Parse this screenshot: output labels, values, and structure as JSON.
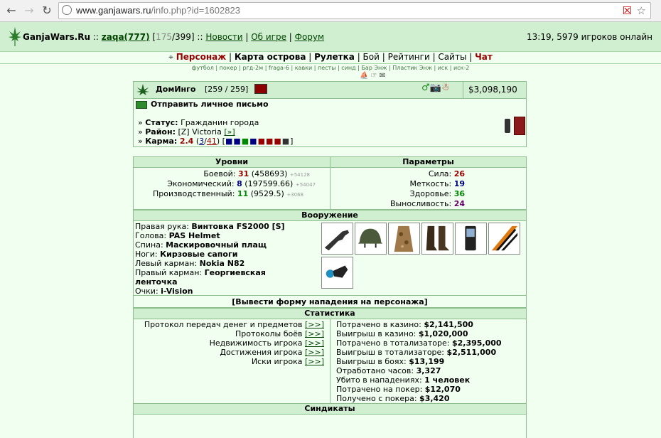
{
  "browser": {
    "url_host": "www.ganjawars.ru",
    "url_path": "/info.php?id=1602823"
  },
  "site": {
    "brand": "GanjaWars.Ru",
    "separator": "::",
    "user": "zaqa(777)",
    "counter_a": "175",
    "counter_b": "399",
    "links": [
      "Новости",
      "Об игре",
      "Форум"
    ],
    "status": "13:19, 5979 игроков онлайн"
  },
  "menu": {
    "items": [
      "Персонаж",
      "Карта острова",
      "Рулетка",
      "Бой",
      "Рейтинги",
      "Сайты",
      "Чат"
    ]
  },
  "submenu": [
    "футбол",
    "покер",
    "ргд-2м",
    "fraga-6",
    "кавки",
    "песты",
    "синд",
    "Бар Энж",
    "Пластик Энж",
    "иск",
    "иск-2"
  ],
  "profile": {
    "name": "ДомИнго",
    "hp": "[259 / 259]",
    "money": "$3,098,190",
    "send_message": "Отправить личное письмо",
    "status_label": "Статус:",
    "status_value": "Гражданин города",
    "district_label": "Район:",
    "district_value": "[Z] Victoria",
    "district_link": "[»]",
    "karma_label": "Карма:",
    "karma_value": "2.4",
    "karma_open": "(",
    "karma_pos": "3",
    "karma_slash": "/",
    "karma_neg": "41",
    "karma_close": ")"
  },
  "levels": {
    "title": "Уровни",
    "rows": [
      {
        "label": "Боевой:",
        "level": "31",
        "value": "(458693)",
        "delta": "+54128",
        "color": "#990000"
      },
      {
        "label": "Экономический:",
        "level": "8",
        "value": "(197599.66)",
        "delta": "+54047",
        "color": "#000080"
      },
      {
        "label": "Производственный:",
        "level": "11",
        "value": "(9529.5)",
        "delta": "+3068",
        "color": "#008800"
      }
    ]
  },
  "params": {
    "title": "Параметры",
    "rows": [
      {
        "label": "Сила:",
        "value": "26",
        "color": "#990000"
      },
      {
        "label": "Меткость:",
        "value": "19",
        "color": "#000080"
      },
      {
        "label": "Здоровье:",
        "value": "36",
        "color": "#008800"
      },
      {
        "label": "Выносливость:",
        "value": "24",
        "color": "#660066"
      }
    ]
  },
  "weapons": {
    "title": "Вооружение",
    "rows": [
      {
        "label": "Правая рука:",
        "value": "Винтовка FS2000 [S]"
      },
      {
        "label": "Голова:",
        "value": "PAS Helmet"
      },
      {
        "label": "Спина:",
        "value": "Маскировочный плащ"
      },
      {
        "label": "Ноги:",
        "value": "Кирзовые сапоги"
      },
      {
        "label": "Левый карман:",
        "value": "Nokia N82"
      },
      {
        "label": "Правый карман:",
        "value": "Георгиевская ленточка"
      },
      {
        "label": "Очки:",
        "value": "i-Vision"
      }
    ],
    "attack_form": "[Вывести форму нападения на персонажа]"
  },
  "stats": {
    "title": "Статистика",
    "links": [
      {
        "label": "Протокол передач денег и предметов",
        "link": "[>>]"
      },
      {
        "label": "Протоколы боёв",
        "link": "[>>]"
      },
      {
        "label": "Недвижимость игрока",
        "link": "[>>]"
      },
      {
        "label": "Достижения игрока",
        "link": "[>>]"
      },
      {
        "label": "Иски игрока",
        "link": "[>>]"
      }
    ],
    "values": [
      {
        "label": "Потрачено в казино:",
        "value": "$2,141,500"
      },
      {
        "label": "Выигрыш в казино:",
        "value": "$1,020,000"
      },
      {
        "label": "Потрачено в тотализаторе:",
        "value": "$2,395,000"
      },
      {
        "label": "Выигрыш в тотализаторе:",
        "value": "$2,511,000"
      },
      {
        "label": "Выигрыш в боях:",
        "value": "$13,199"
      },
      {
        "label": "Отработано часов:",
        "value": "3,327"
      },
      {
        "label": "Убито в нападениях:",
        "value": "1 человек"
      },
      {
        "label": "Потрачено на покер:",
        "value": "$12,070"
      },
      {
        "label": "Получено с покера:",
        "value": "$3,420"
      }
    ]
  },
  "syndicates": {
    "title": "Синдикаты"
  }
}
